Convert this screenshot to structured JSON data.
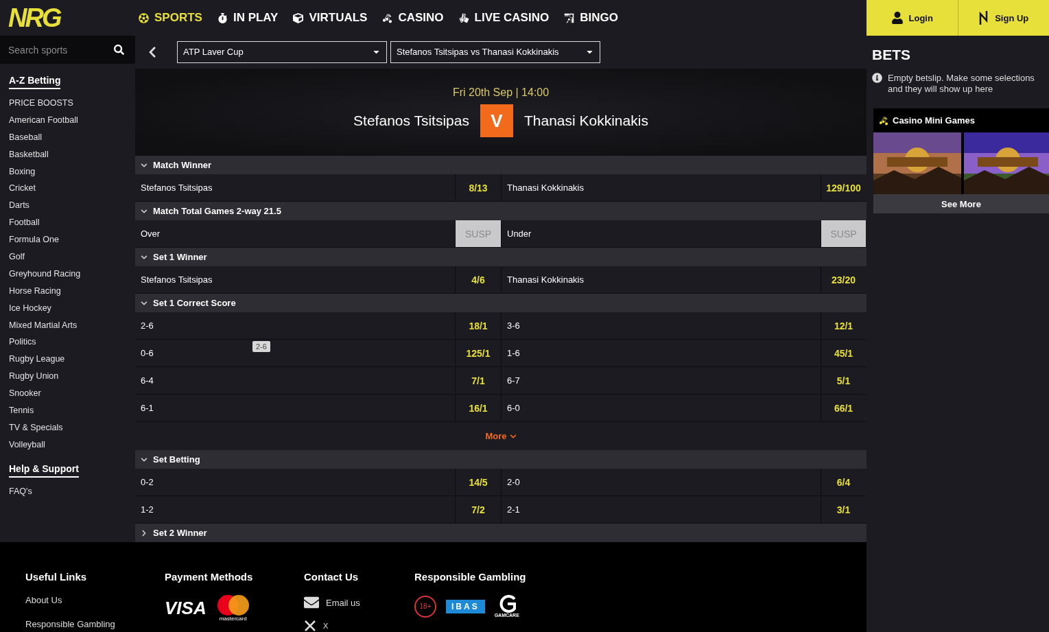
{
  "logo": "NRG",
  "nav": [
    {
      "label": "SPORTS",
      "selected": true
    },
    {
      "label": "IN PLAY",
      "selected": false
    },
    {
      "label": "VIRTUALS",
      "selected": false
    },
    {
      "label": "CASINO",
      "selected": false
    },
    {
      "label": "LIVE CASINO",
      "selected": false
    },
    {
      "label": "BINGO",
      "selected": false
    }
  ],
  "auth": [
    {
      "label": "Login",
      "kind": "login"
    },
    {
      "label": "Sign Up",
      "kind": "signup"
    }
  ],
  "search": {
    "placeholder": "Search sports"
  },
  "sidebar": [
    {
      "title": "A-Z Betting",
      "items": [
        "PRICE BOOSTS",
        "American Football",
        "Baseball",
        "Basketball",
        "Boxing",
        "Cricket",
        "Darts",
        "Football",
        "Formula One",
        "Golf",
        "Greyhound Racing",
        "Horse Racing",
        "Ice Hockey",
        "Mixed Martial Arts",
        "Politics",
        "Rugby League",
        "Rugby Union",
        "Snooker",
        "Tennis",
        "TV & Specials",
        "Volleyball"
      ]
    },
    {
      "title": "Help & Support",
      "items": [
        "FAQ's"
      ]
    }
  ],
  "filters": [
    "ATP Laver Cup",
    "Stefanos Tsitsipas vs Thanasi Kokkinakis"
  ],
  "event": {
    "date": "Fri 20th Sep | 14:00",
    "home": "Stefanos Tsitsipas",
    "versus": "V",
    "away": "Thanasi Kokkinakis"
  },
  "markets": [
    {
      "title": "Match Winner",
      "expanded": true,
      "rows": [
        {
          "left": {
            "name": "Stefanos Tsitsipas",
            "price": "8/13",
            "suspended": false
          },
          "right": {
            "name": "Thanasi Kokkinakis",
            "price": "129/100",
            "suspended": false
          }
        }
      ]
    },
    {
      "title": "Match Total Games 2-way 21.5",
      "expanded": true,
      "rows": [
        {
          "left": {
            "name": "Over",
            "price": "SUSP",
            "suspended": true
          },
          "right": {
            "name": "Under",
            "price": "SUSP",
            "suspended": true
          }
        }
      ]
    },
    {
      "title": "Set 1 Winner",
      "expanded": true,
      "rows": [
        {
          "left": {
            "name": "Stefanos Tsitsipas",
            "price": "4/6",
            "suspended": false
          },
          "right": {
            "name": "Thanasi Kokkinakis",
            "price": "23/20",
            "suspended": false
          }
        }
      ]
    },
    {
      "title": "Set 1 Correct Score",
      "expanded": true,
      "more": "More",
      "rows": [
        {
          "left": {
            "name": "2-6",
            "price": "18/1",
            "suspended": false
          },
          "right": {
            "name": "3-6",
            "price": "12/1",
            "suspended": false
          }
        },
        {
          "left": {
            "name": "0-6",
            "price": "125/1",
            "suspended": false
          },
          "right": {
            "name": "1-6",
            "price": "45/1",
            "suspended": false
          },
          "tooltip": "2-6"
        },
        {
          "left": {
            "name": "6-4",
            "price": "7/1",
            "suspended": false
          },
          "right": {
            "name": "6-7",
            "price": "5/1",
            "suspended": false
          }
        },
        {
          "left": {
            "name": "6-1",
            "price": "16/1",
            "suspended": false
          },
          "right": {
            "name": "6-0",
            "price": "66/1",
            "suspended": false
          }
        }
      ]
    },
    {
      "title": "Set Betting",
      "expanded": true,
      "rows": [
        {
          "left": {
            "name": "0-2",
            "price": "14/5",
            "suspended": false
          },
          "right": {
            "name": "2-0",
            "price": "6/4",
            "suspended": false
          }
        },
        {
          "left": {
            "name": "1-2",
            "price": "7/2",
            "suspended": false
          },
          "right": {
            "name": "2-1",
            "price": "3/1",
            "suspended": false
          }
        }
      ]
    },
    {
      "title": "Set 2 Winner",
      "expanded": false
    }
  ],
  "betslip": {
    "title": "BETS",
    "message": "Empty betslip. Make some selections and they will show up here"
  },
  "casino": {
    "title": "Casino Mini Games",
    "button": "See More"
  },
  "footer": [
    {
      "title": "Useful Links",
      "kind": "links",
      "items": [
        {
          "label": "About Us"
        },
        {
          "label": "Responsible Gambling"
        }
      ]
    },
    {
      "title": "Payment Methods",
      "kind": "logos",
      "items": [
        {
          "kind": "visa",
          "label": "VISA"
        },
        {
          "kind": "mastercard",
          "label": "mastercard"
        }
      ]
    },
    {
      "title": "Contact Us",
      "kind": "contacts",
      "items": [
        {
          "kind": "email",
          "label": "Email us"
        },
        {
          "kind": "x",
          "label": "X"
        }
      ]
    },
    {
      "title": "Responsible Gambling",
      "kind": "logos",
      "items": [
        {
          "kind": "age",
          "label": "18+"
        },
        {
          "kind": "ibas",
          "label": "IBAS"
        },
        {
          "kind": "gamcare",
          "label": "GAMCARE"
        }
      ]
    }
  ]
}
